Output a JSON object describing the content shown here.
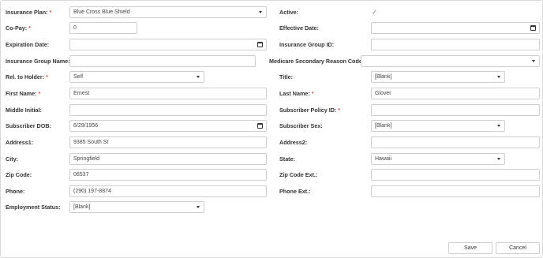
{
  "form": {
    "insurance_plan": {
      "label": "Insurance Plan:",
      "req": "*",
      "value": "Blue Cross Blue Shield"
    },
    "active": {
      "label": "Active:",
      "check": "✓"
    },
    "copay": {
      "label": "Co-Pay:",
      "req": "*",
      "value": "0"
    },
    "effective_date": {
      "label": "Effective Date:",
      "value": ""
    },
    "expiration_date": {
      "label": "Expiration Date:",
      "value": ""
    },
    "insurance_group_id": {
      "label": "Insurance Group ID:",
      "value": ""
    },
    "insurance_group_name": {
      "label": "Insurance Group Name:",
      "value": ""
    },
    "medicare_secondary_reason": {
      "label": "Medicare Secondary Reason Code:",
      "value": ""
    },
    "rel_to_holder": {
      "label": "Rel. to Holder:",
      "req": "*",
      "value": "Self"
    },
    "title": {
      "label": "Title:",
      "value": "[Blank]"
    },
    "first_name": {
      "label": "First Name:",
      "req": "*",
      "value": "Ernest"
    },
    "last_name": {
      "label": "Last Name:",
      "req": "*",
      "value": "Glover"
    },
    "middle_initial": {
      "label": "Middle Initial:",
      "value": ""
    },
    "subscriber_policy_id": {
      "label": "Subscriber Policy ID:",
      "req": "*",
      "value": ""
    },
    "subscriber_dob": {
      "label": "Subscriber DOB:",
      "value": "6/29/1956"
    },
    "subscriber_sex": {
      "label": "Subscriber Sex:",
      "value": "[Blank]"
    },
    "address1": {
      "label": "Address1:",
      "value": "9385 South St"
    },
    "address2": {
      "label": "Address2:",
      "value": ""
    },
    "city": {
      "label": "City:",
      "value": "Springfield"
    },
    "state": {
      "label": "State:",
      "value": "Hawaii"
    },
    "zip_code": {
      "label": "Zip Code:",
      "value": "06537"
    },
    "zip_code_ext": {
      "label": "Zip Code Ext.:",
      "value": ""
    },
    "phone": {
      "label": "Phone:",
      "value": "(290) 197-8874"
    },
    "phone_ext": {
      "label": "Phone Ext.:",
      "value": ""
    },
    "employment_status": {
      "label": "Employment Status:",
      "value": "[Blank]"
    }
  },
  "buttons": {
    "save": "Save",
    "cancel": "Cancel"
  }
}
